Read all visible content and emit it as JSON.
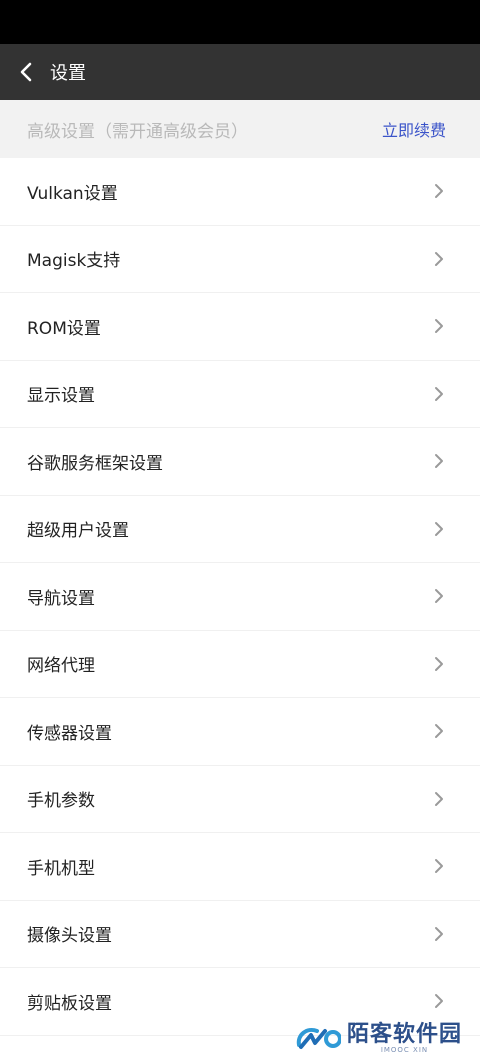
{
  "header": {
    "title": "设置",
    "back_icon": "chevron-left-icon"
  },
  "section": {
    "title": "高级设置（需开通高级会员）",
    "action_label": "立即续费",
    "action_color": "#3b54c9"
  },
  "items": [
    {
      "label": "Vulkan设置"
    },
    {
      "label": "Magisk支持"
    },
    {
      "label": "ROM设置"
    },
    {
      "label": "显示设置"
    },
    {
      "label": "谷歌服务框架设置"
    },
    {
      "label": "超级用户设置"
    },
    {
      "label": "导航设置"
    },
    {
      "label": "网络代理"
    },
    {
      "label": "传感器设置"
    },
    {
      "label": "手机参数"
    },
    {
      "label": "手机机型"
    },
    {
      "label": "摄像头设置"
    },
    {
      "label": "剪贴板设置"
    }
  ],
  "watermark": {
    "title": "陌客软件园",
    "subtitle": "IMOOC XIN"
  }
}
